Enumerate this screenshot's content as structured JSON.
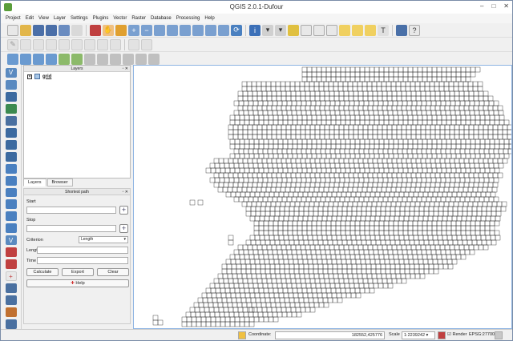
{
  "app": {
    "title": "QGIS 2.0.1-Dufour"
  },
  "window_controls": [
    "–",
    "□",
    "✕"
  ],
  "menu": [
    "Project",
    "Edit",
    "View",
    "Layer",
    "Settings",
    "Plugins",
    "Vector",
    "Raster",
    "Database",
    "Processing",
    "Help"
  ],
  "layers_panel": {
    "title": "Layers",
    "layer_name": "grid"
  },
  "tabs": [
    "Layers",
    "Browser"
  ],
  "shortest_path": {
    "title": "Shortest path",
    "start_label": "Start",
    "stop_label": "Stop",
    "criterion_label": "Criterion",
    "criterion_value": "Length",
    "length_label": "Length",
    "time_label": "Time",
    "calculate": "Calculate",
    "export": "Export",
    "clear": "Clear",
    "help": "Help"
  },
  "status": {
    "coordinate_label": "Coordinate:",
    "coordinate_value": "182552,425776",
    "scale_label": "Scale",
    "scale_value": "1:2239242",
    "render_label": "Render",
    "epsg": "EPSG:27700"
  },
  "colors": {
    "map_grid": "#222222",
    "map_border": "#8eb4e3"
  }
}
